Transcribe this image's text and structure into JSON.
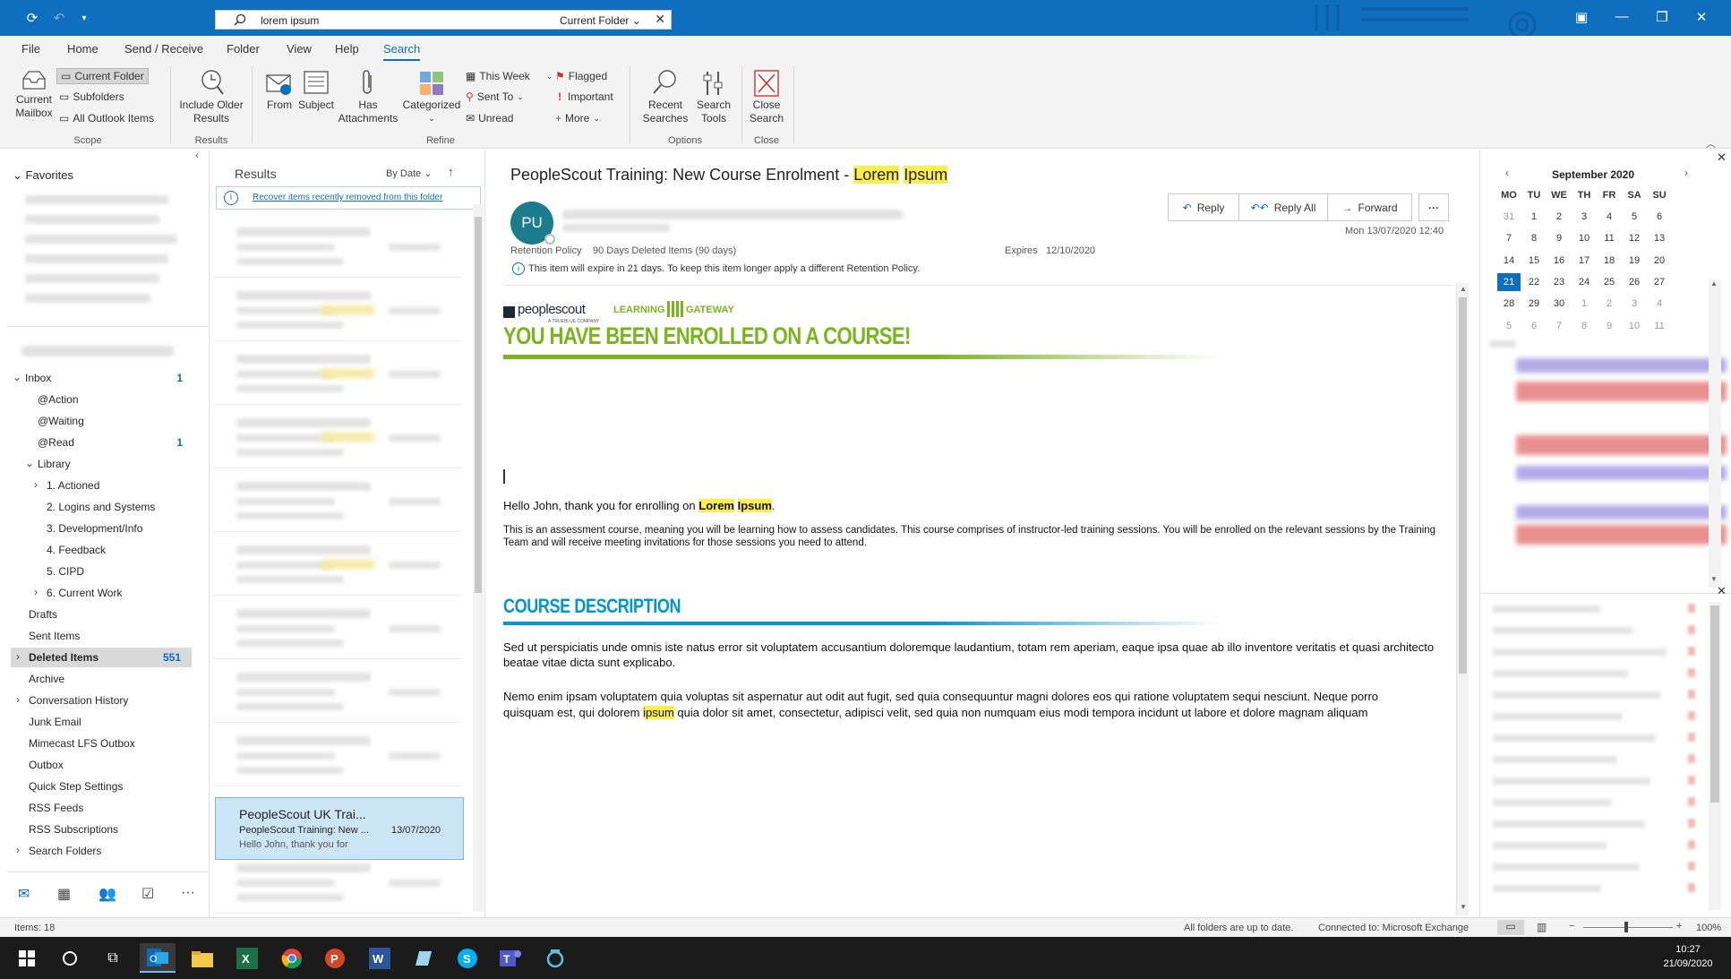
{
  "search": {
    "query": "lorem ipsum",
    "scope": "Current Folder"
  },
  "tabs": [
    "File",
    "Home",
    "Send / Receive",
    "Folder",
    "View",
    "Help",
    "Search"
  ],
  "ribbon": {
    "scope_group": {
      "current_mailbox": "Current Mailbox",
      "current_folder": "Current Folder",
      "subfolders": "Subfolders",
      "all_outlook_items": "All Outlook Items",
      "label": "Scope"
    },
    "results_group": {
      "include_older": "Include Older Results",
      "label": "Results"
    },
    "refine_group": {
      "from": "From",
      "subject": "Subject",
      "has_attachments": "Has Attachments",
      "categorized": "Categorized",
      "this_week": "This Week",
      "sent_to": "Sent To",
      "unread": "Unread",
      "flagged": "Flagged",
      "important": "Important",
      "more": "More",
      "label": "Refine"
    },
    "options_group": {
      "recent_searches": "Recent Searches",
      "search_tools": "Search Tools",
      "label": "Options"
    },
    "close_group": {
      "close_search": "Close Search",
      "label": "Close"
    }
  },
  "folders": {
    "favorites": "Favorites",
    "items": [
      {
        "label": "Inbox",
        "count": "1"
      },
      {
        "label": "@Action",
        "count": ""
      },
      {
        "label": "@Waiting",
        "count": ""
      },
      {
        "label": "@Read",
        "count": "1"
      },
      {
        "label": "Library",
        "count": ""
      },
      {
        "label": "1. Actioned",
        "count": ""
      },
      {
        "label": "2. Logins and Systems",
        "count": ""
      },
      {
        "label": "3. Development/Info",
        "count": ""
      },
      {
        "label": "4. Feedback",
        "count": ""
      },
      {
        "label": "5. CIPD",
        "count": ""
      },
      {
        "label": "6. Current Work",
        "count": ""
      },
      {
        "label": "Drafts",
        "count": ""
      },
      {
        "label": "Sent Items",
        "count": ""
      },
      {
        "label": "Deleted Items",
        "count": "551"
      },
      {
        "label": "Archive",
        "count": ""
      },
      {
        "label": "Conversation History",
        "count": ""
      },
      {
        "label": "Junk Email",
        "count": ""
      },
      {
        "label": "Mimecast LFS Outbox",
        "count": ""
      },
      {
        "label": "Outbox",
        "count": ""
      },
      {
        "label": "Quick Step Settings",
        "count": ""
      },
      {
        "label": "RSS Feeds",
        "count": ""
      },
      {
        "label": "RSS Subscriptions",
        "count": ""
      },
      {
        "label": "Search Folders",
        "count": ""
      }
    ]
  },
  "results": {
    "title": "Results",
    "sort": "By Date",
    "recover_link": "Recover items recently removed from this folder",
    "selected": {
      "sender": "PeopleScout UK Trai...",
      "subject": "PeopleScout Training: New ...",
      "date": "13/07/2020",
      "preview": "Hello John, thank you for"
    }
  },
  "message": {
    "subject_prefix": "PeopleScout Training: New Course Enrolment - ",
    "subject_hl1": "Lorem",
    "subject_hl2": "Ipsum",
    "avatar": "PU",
    "retention_label": "Retention Policy",
    "retention_value": "90 Days Deleted Items (90 days)",
    "expires_label": "Expires",
    "expires_value": "12/10/2020",
    "expiry_notice": "This item will expire in 21 days. To keep this item longer apply a different Retention Policy.",
    "received": "Mon 13/07/2020 12:40",
    "reply": "Reply",
    "reply_all": "Reply All",
    "forward": "Forward",
    "brand_peoplescout": "peoplescout",
    "brand_tagline": "A TRUEBLUE COMPANY",
    "brand_lg_left": "LEARNING",
    "brand_lg_right": "GATEWAY",
    "headline": "YOU HAVE BEEN ENROLLED ON A COURSE!",
    "greeting_prefix": "Hello John, thank you for enrolling on ",
    "greeting_hl1": "Lorem",
    "greeting_hl2": "Ipsum",
    "greeting_suffix": ".",
    "para1": "This is an assessment course, meaning you will be learning how to assess candidates.  This course comprises of instructor-led training sessions.  You will be enrolled on the relevant sessions by the Training Team and will receive meeting invitations for those sessions you need to attend.",
    "course_heading": "COURSE DESCRIPTION",
    "para2": "Sed ut perspiciatis unde omnis iste natus error sit voluptatem accusantium doloremque laudantium, totam rem aperiam, eaque ipsa quae ab illo inventore veritatis et quasi architecto beatae vitae dicta sunt explicabo.",
    "para3_line1": "Nemo enim ipsam voluptatem quia voluptas sit aspernatur aut odit aut fugit, sed quia consequuntur magni dolores eos qui ratione voluptatem sequi nesciunt. Neque porro",
    "para3_line2_prefix": "quisquam est, qui dolorem ",
    "para3_line2_hl": "ipsum",
    "para3_line2_suffix": " quia dolor sit amet, consectetur, adipisci velit, sed quia non numquam eius modi tempora incidunt ut labore et dolore magnam aliquam"
  },
  "calendar": {
    "month": "September 2020",
    "weekdays": [
      "MO",
      "TU",
      "WE",
      "TH",
      "FR",
      "SA",
      "SU"
    ],
    "weeks": [
      [
        "31",
        "1",
        "2",
        "3",
        "4",
        "5",
        "6"
      ],
      [
        "7",
        "8",
        "9",
        "10",
        "11",
        "12",
        "13"
      ],
      [
        "14",
        "15",
        "16",
        "17",
        "18",
        "19",
        "20"
      ],
      [
        "21",
        "22",
        "23",
        "24",
        "25",
        "26",
        "27"
      ],
      [
        "28",
        "29",
        "30",
        "1",
        "2",
        "3",
        "4"
      ],
      [
        "5",
        "6",
        "7",
        "8",
        "9",
        "10",
        "11"
      ]
    ],
    "today": "21"
  },
  "status": {
    "items": "Items: 18",
    "sync": "All folders are up to date.",
    "connection": "Connected to: Microsoft Exchange",
    "zoom": "100%"
  },
  "taskbar": {
    "time": "10:27",
    "date": "21/09/2020"
  },
  "colors": {
    "accent": "#106ebe",
    "green_headline": "#7ab51d",
    "blue_heading": "#0096d6",
    "highlight": "#ffed4a"
  }
}
